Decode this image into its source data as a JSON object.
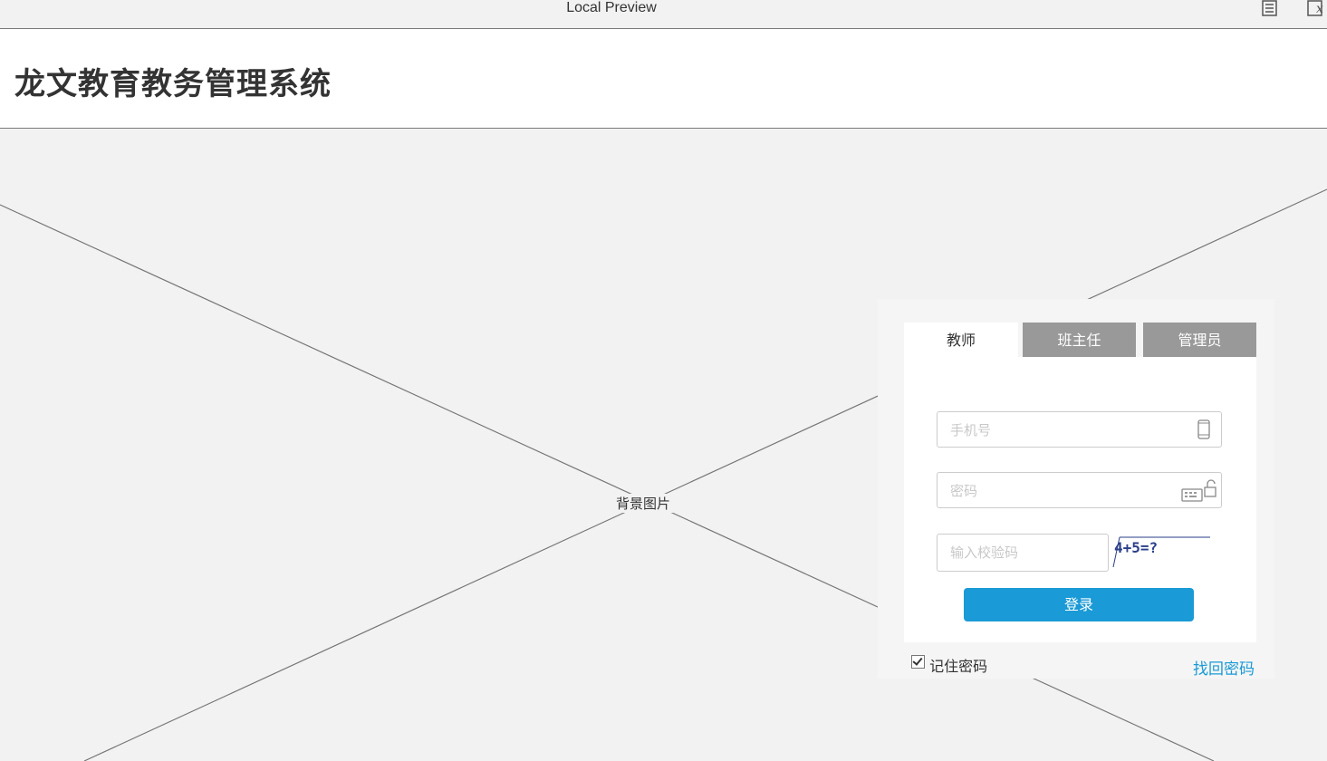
{
  "window": {
    "title": "Local Preview",
    "icons": [
      "document-icon",
      "close-icon"
    ]
  },
  "header": {
    "title": "龙文教育教务管理系统"
  },
  "background": {
    "label": "背景图片"
  },
  "login": {
    "tabs": [
      {
        "label": "教师",
        "active": true
      },
      {
        "label": "班主任",
        "active": false
      },
      {
        "label": "管理员",
        "active": false
      }
    ],
    "phone_placeholder": "手机号",
    "password_placeholder": "密码",
    "captcha_placeholder": "输入校验码",
    "captcha_text": "4+5=?",
    "submit_label": "登录",
    "remember_label": "记住密码",
    "remember_checked": true,
    "forgot_label": "找回密码"
  },
  "colors": {
    "accent": "#1a9ad6",
    "tab_inactive": "#999999",
    "background": "#f2f2f2"
  }
}
